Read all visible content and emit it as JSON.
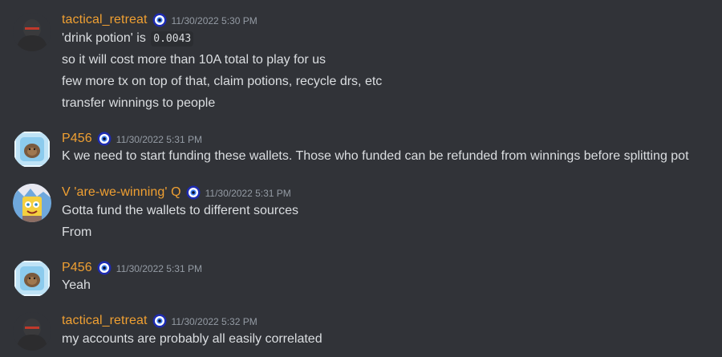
{
  "colors": {
    "background": "#313338",
    "username": "#f0a032",
    "text": "#dbdee1",
    "timestamp": "#949ba4",
    "badge_ring": "#1e2bb0"
  },
  "messages": [
    {
      "username": "tactical_retreat",
      "badge_icon": "evil-eye-badge-icon",
      "timestamp": "11/30/2022 5:30 PM",
      "lines": [
        {
          "prefix": "'drink potion' is",
          "code": "0.0043"
        },
        {
          "text": "so it will cost more than 10A total to play for us"
        },
        {
          "text": "few more tx on top of that, claim potions, recycle drs, etc"
        },
        {
          "text": "transfer winnings to people"
        }
      ]
    },
    {
      "username": "P456",
      "badge_icon": "evil-eye-badge-icon",
      "timestamp": "11/30/2022 5:31 PM",
      "lines": [
        {
          "text": "K we need to start funding these wallets. Those who funded can be refunded from winnings before splitting pot"
        }
      ]
    },
    {
      "username": "V 'are-we-winning' Q",
      "badge_icon": "evil-eye-badge-icon",
      "timestamp": "11/30/2022 5:31 PM",
      "lines": [
        {
          "text": "Gotta fund the wallets to different sources"
        },
        {
          "text": "From"
        }
      ]
    },
    {
      "username": "P456",
      "badge_icon": "evil-eye-badge-icon",
      "timestamp": "11/30/2022 5:31 PM",
      "lines": [
        {
          "text": "Yeah"
        }
      ]
    },
    {
      "username": "tactical_retreat",
      "badge_icon": "evil-eye-badge-icon",
      "timestamp": "11/30/2022 5:32 PM",
      "lines": [
        {
          "text": "my accounts are probably all easily correlated"
        }
      ]
    }
  ]
}
